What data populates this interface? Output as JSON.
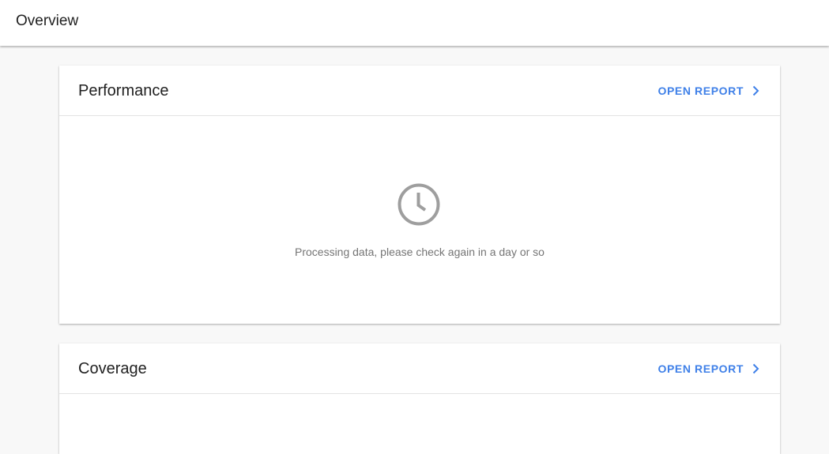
{
  "header": {
    "title": "Overview"
  },
  "cards": [
    {
      "title": "Performance",
      "action_label": "OPEN REPORT",
      "action_icon": "chevron-right-icon",
      "status_icon": "clock-icon",
      "status_message": "Processing data, please check again in a day or so"
    },
    {
      "title": "Coverage",
      "action_label": "OPEN REPORT",
      "action_icon": "chevron-right-icon"
    }
  ],
  "colors": {
    "accent": "#3f80e8",
    "icon_gray": "#9e9e9e",
    "muted_text": "#757575",
    "background": "#f8f8f8"
  }
}
